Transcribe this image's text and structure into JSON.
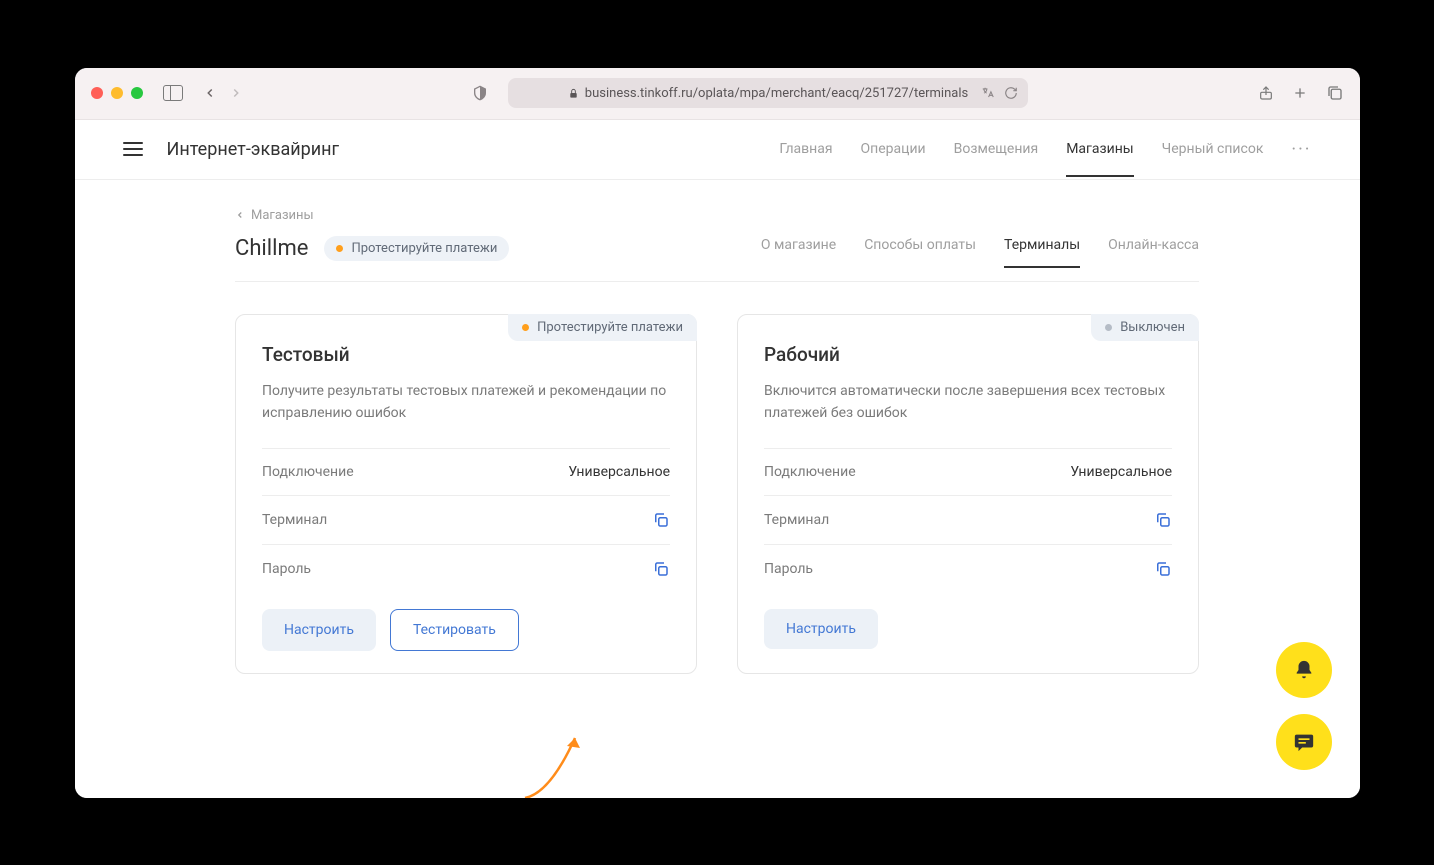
{
  "browser": {
    "url": "business.tinkoff.ru/oplata/mpa/merchant/eacq/251727/terminals"
  },
  "topnav": {
    "title": "Интернет-эквайринг",
    "items": [
      "Главная",
      "Операции",
      "Возмещения",
      "Магазины",
      "Черный список"
    ]
  },
  "breadcrumb": {
    "label": "Магазины"
  },
  "shop": {
    "name": "Chillme",
    "status": "Протестируйте платежи"
  },
  "subtabs": [
    "О магазине",
    "Способы оплаты",
    "Терминалы",
    "Онлайн-касса"
  ],
  "cards": {
    "test": {
      "badge": "Протестируйте платежи",
      "title": "Тестовый",
      "desc": "Получите результаты тестовых платежей и рекомендации по исправлению ошибок",
      "fields": {
        "connection_label": "Подключение",
        "connection_value": "Универсальное",
        "terminal_label": "Терминал",
        "password_label": "Пароль"
      },
      "actions": {
        "configure": "Настроить",
        "test": "Тестировать"
      }
    },
    "prod": {
      "badge": "Выключен",
      "title": "Рабочий",
      "desc": "Включится автоматически после завершения всех тестовых платежей без ошибок",
      "fields": {
        "connection_label": "Подключение",
        "connection_value": "Универсальное",
        "terminal_label": "Терминал",
        "password_label": "Пароль"
      },
      "actions": {
        "configure": "Настроить"
      }
    }
  }
}
